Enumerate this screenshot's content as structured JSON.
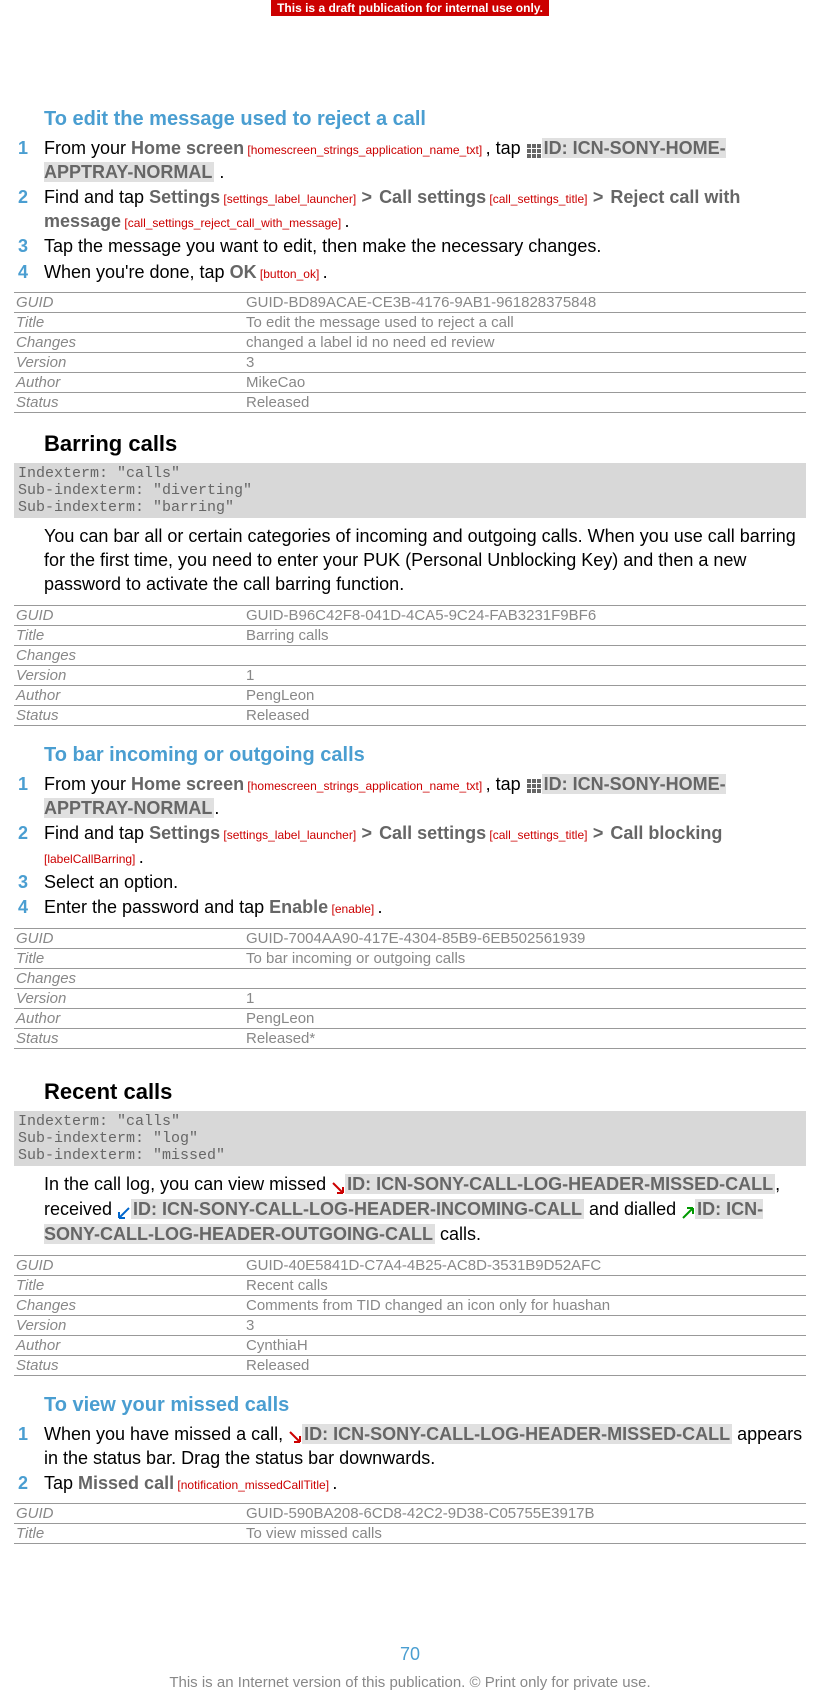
{
  "banner": "This is a draft publication for internal use only.",
  "sec1": {
    "heading": "To edit the message used to reject a call",
    "s1a": "From your ",
    "s1b": "Home screen",
    "s1tag": " [homescreen_strings_application_name_txt] ",
    "s1c": ", tap ",
    "s1icon": "ID: ICN-SONY-HOME-APPTRAY-NORMAL",
    "s1d": " .",
    "s2a": "Find and tap ",
    "s2b": "Settings",
    "s2tag1": " [settings_label_launcher] ",
    "s2c": "Call settings",
    "s2tag2": " [call_settings_title] ",
    "s2d": "Reject call with message",
    "s2tag3": " [call_settings_reject_call_with_message] ",
    "s2e": ".",
    "s3": "Tap the message you want to edit, then make the necessary changes.",
    "s4a": "When you're done, tap ",
    "s4b": "OK",
    "s4tag": " [button_ok] ",
    "s4c": "."
  },
  "meta1": {
    "guid": "GUID-BD89ACAE-CE3B-4176-9AB1-961828375848",
    "title": "To edit the message used to reject a call",
    "changes": "changed a label id no need ed review",
    "version": "3",
    "author": "MikeCao",
    "status": "Released"
  },
  "sec2": {
    "heading": "Barring calls",
    "idx": "Indexterm: \"calls\"\nSub-indexterm: \"diverting\"\nSub-indexterm: \"barring\"",
    "para": "You can bar all or certain categories of incoming and outgoing calls. When you use call barring for the first time, you need to enter your PUK (Personal Unblocking Key) and then a new password to activate the call barring function."
  },
  "meta2": {
    "guid": "GUID-B96C42F8-041D-4CA5-9C24-FAB3231F9BF6",
    "title": "Barring calls",
    "changes": "",
    "version": "1",
    "author": "PengLeon",
    "status": "Released"
  },
  "sec3": {
    "heading": "To bar incoming or outgoing calls",
    "s1a": "From your ",
    "s1b": "Home screen",
    "s1tag": " [homescreen_strings_application_name_txt] ",
    "s1c": ", tap ",
    "s1icon": "ID: ICN-SONY-HOME-APPTRAY-NORMAL",
    "s1d": ".",
    "s2a": "Find and tap ",
    "s2b": "Settings",
    "s2tag1": " [settings_label_launcher] ",
    "s2c": "Call settings",
    "s2tag2": " [call_settings_title] ",
    "s2d": "Call blocking",
    "s2tag3": "[labelCallBarring] ",
    "s2e": ".",
    "s3": "Select an option.",
    "s4a": "Enter the password and tap ",
    "s4b": "Enable",
    "s4tag": " [enable] ",
    "s4c": "."
  },
  "meta3": {
    "guid": "GUID-7004AA90-417E-4304-85B9-6EB502561939",
    "title": "To bar incoming or outgoing calls",
    "changes": "",
    "version": "1",
    "author": "PengLeon",
    "status": "Released*"
  },
  "sec4": {
    "heading": "Recent calls",
    "idx": "Indexterm: \"calls\"\nSub-indexterm: \"log\"\nSub-indexterm: \"missed\"",
    "p1": "In the call log, you can view missed ",
    "i1": "ID: ICN-SONY-CALL-LOG-HEADER-MISSED-CALL",
    "p2": ", received ",
    "i2": "ID: ICN-SONY-CALL-LOG-HEADER-INCOMING-CALL",
    "p3": " and dialled ",
    "i3": "ID: ICN-SONY-CALL-LOG-HEADER-OUTGOING-CALL",
    "p4": " calls."
  },
  "meta4": {
    "guid": "GUID-40E5841D-C7A4-4B25-AC8D-3531B9D52AFC",
    "title": "Recent calls",
    "changes": "Comments from TID changed an icon only for huashan",
    "version": "3",
    "author": "CynthiaH",
    "status": "Released"
  },
  "sec5": {
    "heading": "To view your missed calls",
    "s1a": "When you have missed a call, ",
    "s1icon": "ID: ICN-SONY-CALL-LOG-HEADER-MISSED-CALL",
    "s1b": " appears in the status bar. Drag the status bar downwards.",
    "s2a": "Tap ",
    "s2b": "Missed call",
    "s2tag": " [notification_missedCallTitle] ",
    "s2c": "."
  },
  "meta5": {
    "guid": "GUID-590BA208-6CD8-42C2-9D38-C05755E3917B",
    "title": "To view missed calls"
  },
  "labels": {
    "guid": "GUID",
    "title": "Title",
    "changes": "Changes",
    "version": "Version",
    "author": "Author",
    "status": "Status"
  },
  "pagenum": "70",
  "footer": "This is an Internet version of this publication. © Print only for private use."
}
